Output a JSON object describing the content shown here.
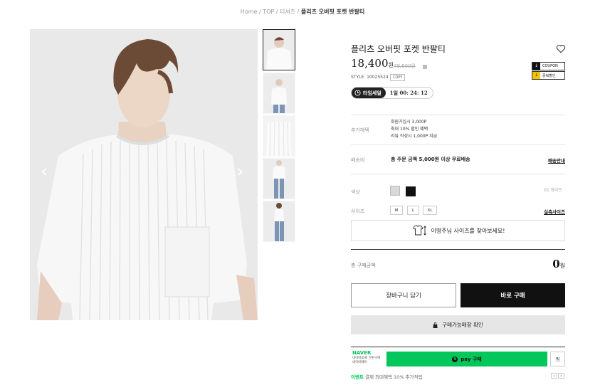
{
  "breadcrumb": {
    "items": [
      "Home",
      "TOP",
      "티셔츠"
    ],
    "separator": "/",
    "current": "플리츠 오버핏 포켓 반팔티"
  },
  "product": {
    "title": "플리츠 오버핏 포켓 반팔티",
    "price": "18,400",
    "price_unit": "원",
    "original_price": "49,800원",
    "style_label": "STYLE. 10025524",
    "copy_label": "COPY",
    "coupons": [
      {
        "label": "COUPON"
      },
      {
        "label": "중복할인"
      }
    ]
  },
  "timesale": {
    "label": "타임세일",
    "remaining": "1일 00: 24: 12"
  },
  "benefits": {
    "label": "추가혜택",
    "lines": [
      "회원가입시 3,000P",
      "최대 10% 할인 혜택",
      "리뷰 작성시 1,000P 지급"
    ]
  },
  "shipping": {
    "label": "배송비",
    "text": "총 주문 금액 5,000원 이상 무료배송",
    "link": "배송안내"
  },
  "color": {
    "label": "색상",
    "swatches": [
      "#d9d9d9",
      "#111111"
    ],
    "selected_text": "01 화이트"
  },
  "size": {
    "label": "사이즈",
    "options": [
      "M",
      "L",
      "XL"
    ],
    "link": "실측사이즈"
  },
  "fit_finder": {
    "text": "이명주님 사이즈를 찾아보세요!"
  },
  "total": {
    "label": "총 구매금액",
    "value": "0",
    "unit": "원"
  },
  "actions": {
    "cart": "장바구니 담기",
    "buy": "바로 구매",
    "stock": "구매가능매장 확인"
  },
  "naver": {
    "logo": "NAVER",
    "sub_line1": "네이버ID로 간편구매",
    "sub_line2": "네이버페이",
    "pay_label": "pay 구매",
    "wish_label": "찜"
  },
  "event": {
    "tag": "이벤트",
    "text": "결제 최대혜택 10% 추가적립"
  },
  "colors": {
    "accent_black": "#111111",
    "naver_green": "#03c75a",
    "coupon_yellow": "#f5c400"
  }
}
